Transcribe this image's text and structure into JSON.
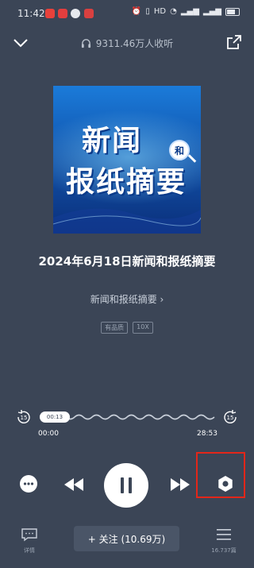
{
  "status_bar": {
    "time": "11:42",
    "notification_icons": [
      "video-app-icon",
      "red-app-icon",
      "wechat-icon",
      "red-square-app-icon"
    ],
    "right_icons": [
      "alarm-icon",
      "vibrate-icon",
      "nfc-icon",
      "wifi-icon",
      "signal-5g-icon",
      "signal-5g-icon",
      "battery-icon"
    ],
    "hd_label": "HD"
  },
  "header": {
    "listeners": "9311.46万人收听"
  },
  "cover": {
    "line1": "新闻",
    "badge": "和",
    "line2": "报纸摘要"
  },
  "episode": {
    "title": "2024年6月18日新闻和报纸摘要",
    "album": "新闻和报纸摘要 ›",
    "tags": [
      "有品质",
      "10X"
    ]
  },
  "player": {
    "rewind_seconds": "15",
    "forward_seconds": "15",
    "bubble_time": "00:13",
    "current_time": "00:00",
    "total_time": "28:53",
    "progress_fraction": 0.0
  },
  "bottom": {
    "detail_label": "详情",
    "follow_label": "+ 关注 (10.69万)",
    "list_label": "16.737篇"
  },
  "colors": {
    "background": "#3b4556",
    "highlight": "#e32619",
    "cover_blue": "#1259b3"
  }
}
